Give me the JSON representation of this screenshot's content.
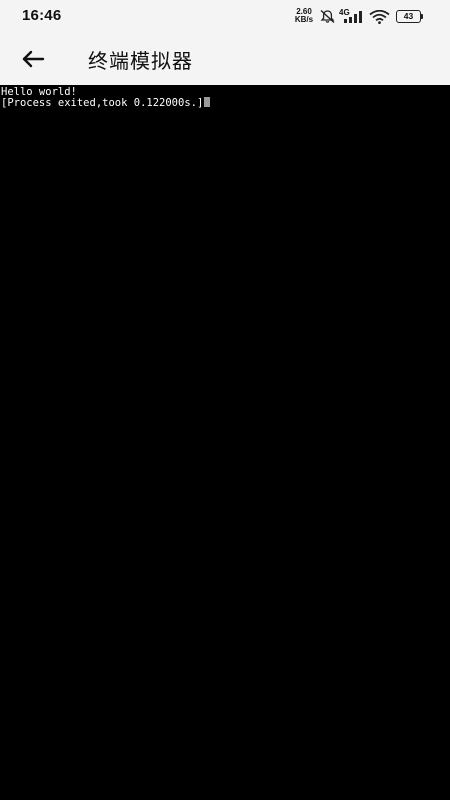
{
  "status_bar": {
    "time": "16:46",
    "net_speed_value": "2.60",
    "net_speed_unit": "KB/s",
    "network_type": "4G",
    "battery_level": "43",
    "icons": [
      "mute-icon",
      "signal-icon",
      "wifi-icon",
      "battery-icon"
    ]
  },
  "app_bar": {
    "title": "终端模拟器",
    "back_icon": "arrow-left-icon"
  },
  "terminal": {
    "lines": [
      "Hello world!",
      "[Process exited,took 0.122000s.]"
    ],
    "background_color": "#000000",
    "text_color": "#ffffff",
    "cursor_color": "#9a9a9a"
  }
}
